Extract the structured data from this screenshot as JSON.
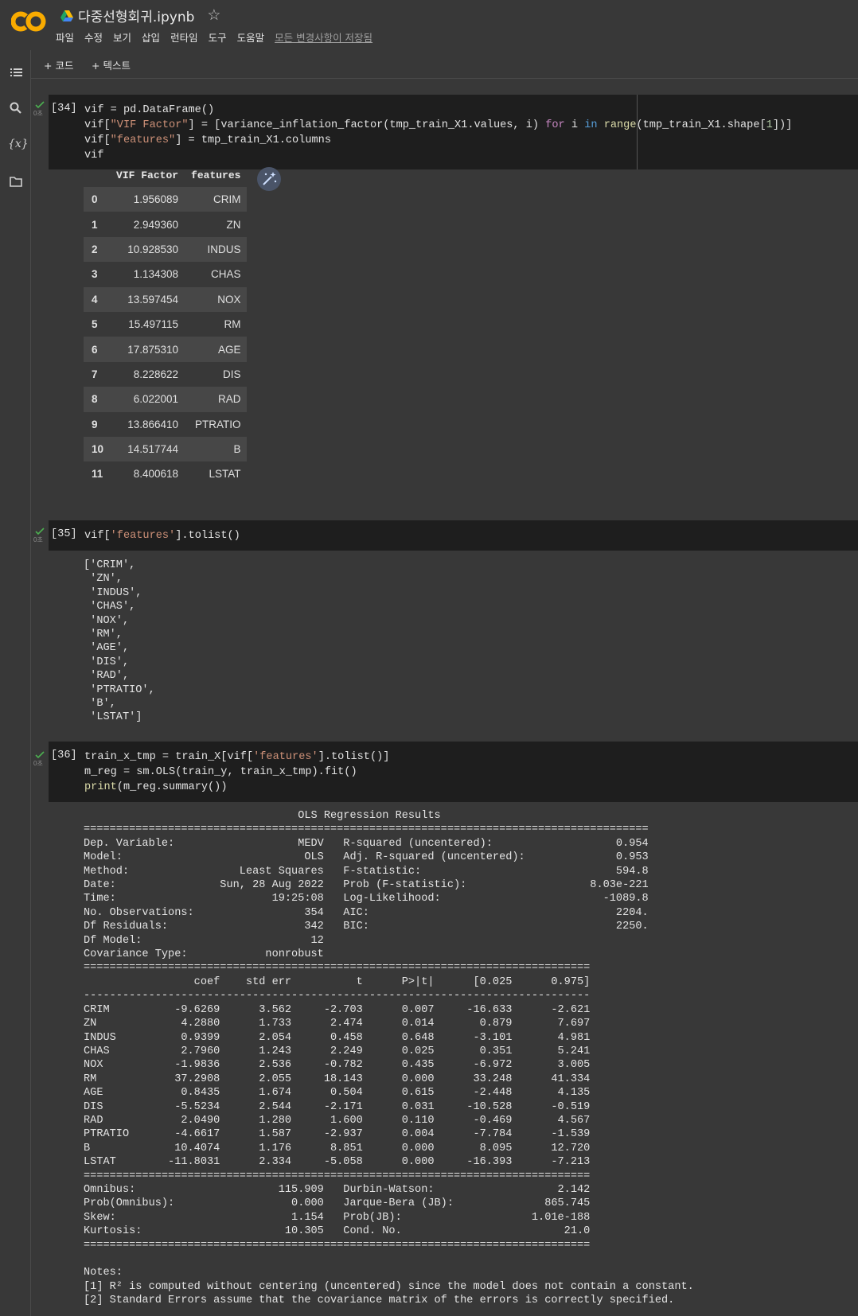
{
  "header": {
    "doc_title": "다중선형회귀.ipynb",
    "menu": [
      "파일",
      "수정",
      "보기",
      "삽입",
      "런타임",
      "도구",
      "도움말"
    ],
    "saved_status": "모든 변경사항이 저장됨"
  },
  "toolbar": {
    "add_code": "+ 코드",
    "add_text": "+ 텍스트"
  },
  "sidebar": {
    "icons": [
      "toc-icon",
      "search-icon",
      "variables-icon",
      "folder-icon"
    ],
    "variables_label": "{x}"
  },
  "cells": [
    {
      "exec_count": "[34]",
      "time": "0초",
      "code_lines": [
        "vif = pd.DataFrame()",
        "vif[\"VIF Factor\"] = [variance_inflation_factor(tmp_train_X1.values, i) for i in range(tmp_train_X1.shape[1])]",
        "vif[\"features\"] = tmp_train_X1.columns",
        "vif"
      ],
      "table": {
        "columns": [
          "",
          "VIF Factor",
          "features"
        ],
        "rows": [
          [
            "0",
            "1.956089",
            "CRIM"
          ],
          [
            "1",
            "2.949360",
            "ZN"
          ],
          [
            "2",
            "10.928530",
            "INDUS"
          ],
          [
            "3",
            "1.134308",
            "CHAS"
          ],
          [
            "4",
            "13.597454",
            "NOX"
          ],
          [
            "5",
            "15.497115",
            "RM"
          ],
          [
            "6",
            "17.875310",
            "AGE"
          ],
          [
            "7",
            "8.228622",
            "DIS"
          ],
          [
            "8",
            "6.022001",
            "RAD"
          ],
          [
            "9",
            "13.866410",
            "PTRATIO"
          ],
          [
            "10",
            "14.517744",
            "B"
          ],
          [
            "11",
            "8.400618",
            "LSTAT"
          ]
        ]
      }
    },
    {
      "exec_count": "[35]",
      "time": "0초",
      "code_lines": [
        "vif['features'].tolist()"
      ],
      "output": "['CRIM',\n 'ZN',\n 'INDUS',\n 'CHAS',\n 'NOX',\n 'RM',\n 'AGE',\n 'DIS',\n 'RAD',\n 'PTRATIO',\n 'B',\n 'LSTAT']"
    },
    {
      "exec_count": "[36]",
      "time": "0초",
      "code_lines": [
        "train_x_tmp = train_X[vif['features'].tolist()]",
        "m_reg = sm.OLS(train_y, train_x_tmp).fit()",
        "print(m_reg.summary())"
      ],
      "output": "                                 OLS Regression Results                                \n=======================================================================================\nDep. Variable:                   MEDV   R-squared (uncentered):                   0.954\nModel:                            OLS   Adj. R-squared (uncentered):              0.953\nMethod:                 Least Squares   F-statistic:                              594.8\nDate:                Sun, 28 Aug 2022   Prob (F-statistic):                   8.03e-221\nTime:                        19:25:08   Log-Likelihood:                         -1089.8\nNo. Observations:                 354   AIC:                                      2204.\nDf Residuals:                     342   BIC:                                      2250.\nDf Model:                          12                                                  \nCovariance Type:            nonrobust                                                  \n==============================================================================\n                 coef    std err          t      P>|t|      [0.025      0.975]\n------------------------------------------------------------------------------\nCRIM          -9.6269      3.562     -2.703      0.007     -16.633      -2.621\nZN             4.2880      1.733      2.474      0.014       0.879       7.697\nINDUS          0.9399      2.054      0.458      0.648      -3.101       4.981\nCHAS           2.7960      1.243      2.249      0.025       0.351       5.241\nNOX           -1.9836      2.536     -0.782      0.435      -6.972       3.005\nRM            37.2908      2.055     18.143      0.000      33.248      41.334\nAGE            0.8435      1.674      0.504      0.615      -2.448       4.135\nDIS           -5.5234      2.544     -2.171      0.031     -10.528      -0.519\nRAD            2.0490      1.280      1.600      0.110      -0.469       4.567\nPTRATIO       -4.6617      1.587     -2.937      0.004      -7.784      -1.539\nB             10.4074      1.176      8.851      0.000       8.095      12.720\nLSTAT        -11.8031      2.334     -5.058      0.000     -16.393      -7.213\n==============================================================================\nOmnibus:                      115.909   Durbin-Watson:                   2.142\nProb(Omnibus):                  0.000   Jarque-Bera (JB):              865.745\nSkew:                           1.154   Prob(JB):                    1.01e-188\nKurtosis:                      10.305   Cond. No.                         21.0\n==============================================================================\n\nNotes:\n[1] R² is computed without centering (uncentered) since the model does not contain a constant.\n[2] Standard Errors assume that the covariance matrix of the errors is correctly specified."
    }
  ]
}
